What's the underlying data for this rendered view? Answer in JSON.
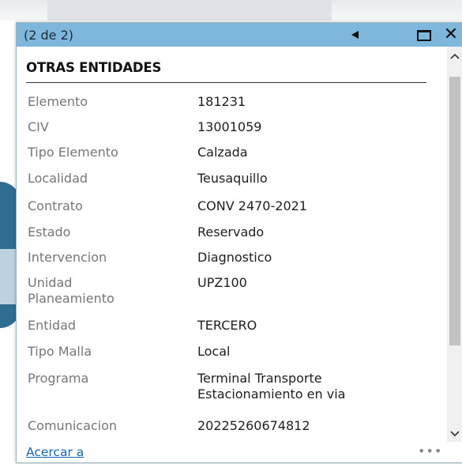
{
  "popup": {
    "pager": "(2 de 2)",
    "section_title": "OTRAS ENTIDADES",
    "fields": [
      {
        "label": "Elemento",
        "value": "181231"
      },
      {
        "label": "CIV",
        "value": "13001059"
      },
      {
        "label": "Tipo Elemento",
        "value": "Calzada"
      },
      {
        "label": "Localidad",
        "value": "Teusaquillo"
      },
      {
        "label": "Contrato",
        "value": "CONV 2470-2021"
      },
      {
        "label": "Estado",
        "value": "Reservado"
      },
      {
        "label": "Intervencion",
        "value": "Diagnostico"
      },
      {
        "label": "Unidad Planeamiento",
        "value": "UPZ100"
      },
      {
        "label": "Entidad",
        "value": "TERCERO"
      },
      {
        "label": "Tipo Malla",
        "value": "Local"
      },
      {
        "label": "Programa",
        "value": "Terminal Transporte Estacionamiento en via"
      },
      {
        "label": "Comunicacion",
        "value": "20225260674812"
      }
    ],
    "footer": {
      "zoom_link": "Acercar a",
      "more": "•••"
    },
    "icons": {
      "prev": "triangle-left-icon",
      "maximize": "maximize-icon",
      "close": "close-icon",
      "scroll_up": "chevron-up-icon",
      "scroll_down": "chevron-down-icon"
    },
    "colors": {
      "titlebar": "#7fb6dc",
      "link": "#1565b8",
      "label": "#767676"
    }
  }
}
